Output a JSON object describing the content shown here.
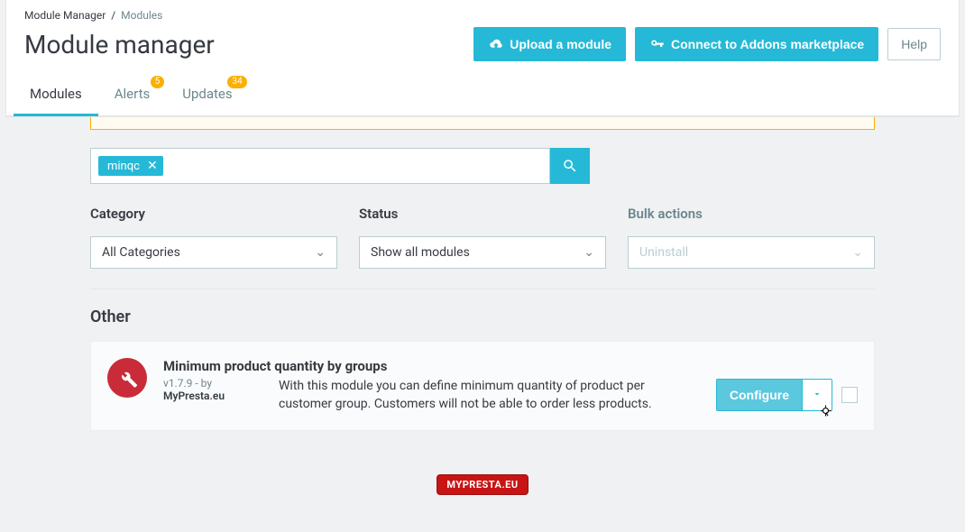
{
  "breadcrumb": {
    "parent": "Module Manager",
    "sep": "/",
    "current": "Modules"
  },
  "page_title": "Module manager",
  "header_buttons": {
    "upload": "Upload a module",
    "connect": "Connect to Addons marketplace",
    "help": "Help"
  },
  "tabs": {
    "modules": "Modules",
    "alerts": {
      "label": "Alerts",
      "badge": "5"
    },
    "updates": {
      "label": "Updates",
      "badge": "34"
    }
  },
  "search": {
    "tag": "minqc"
  },
  "filters": {
    "category": {
      "label": "Category",
      "value": "All Categories"
    },
    "status": {
      "label": "Status",
      "value": "Show all modules"
    },
    "bulk": {
      "label": "Bulk actions",
      "value": "Uninstall"
    }
  },
  "section": {
    "title": "Other"
  },
  "module": {
    "name": "Minimum product quantity by groups",
    "version": "v1.7.9 - by",
    "author": "MyPresta.eu",
    "description": "With this module you can define minimum quantity of product per customer group. Customers will not be able to order less products.",
    "configure": "Configure"
  },
  "footer": "MYPRESTA.EU"
}
